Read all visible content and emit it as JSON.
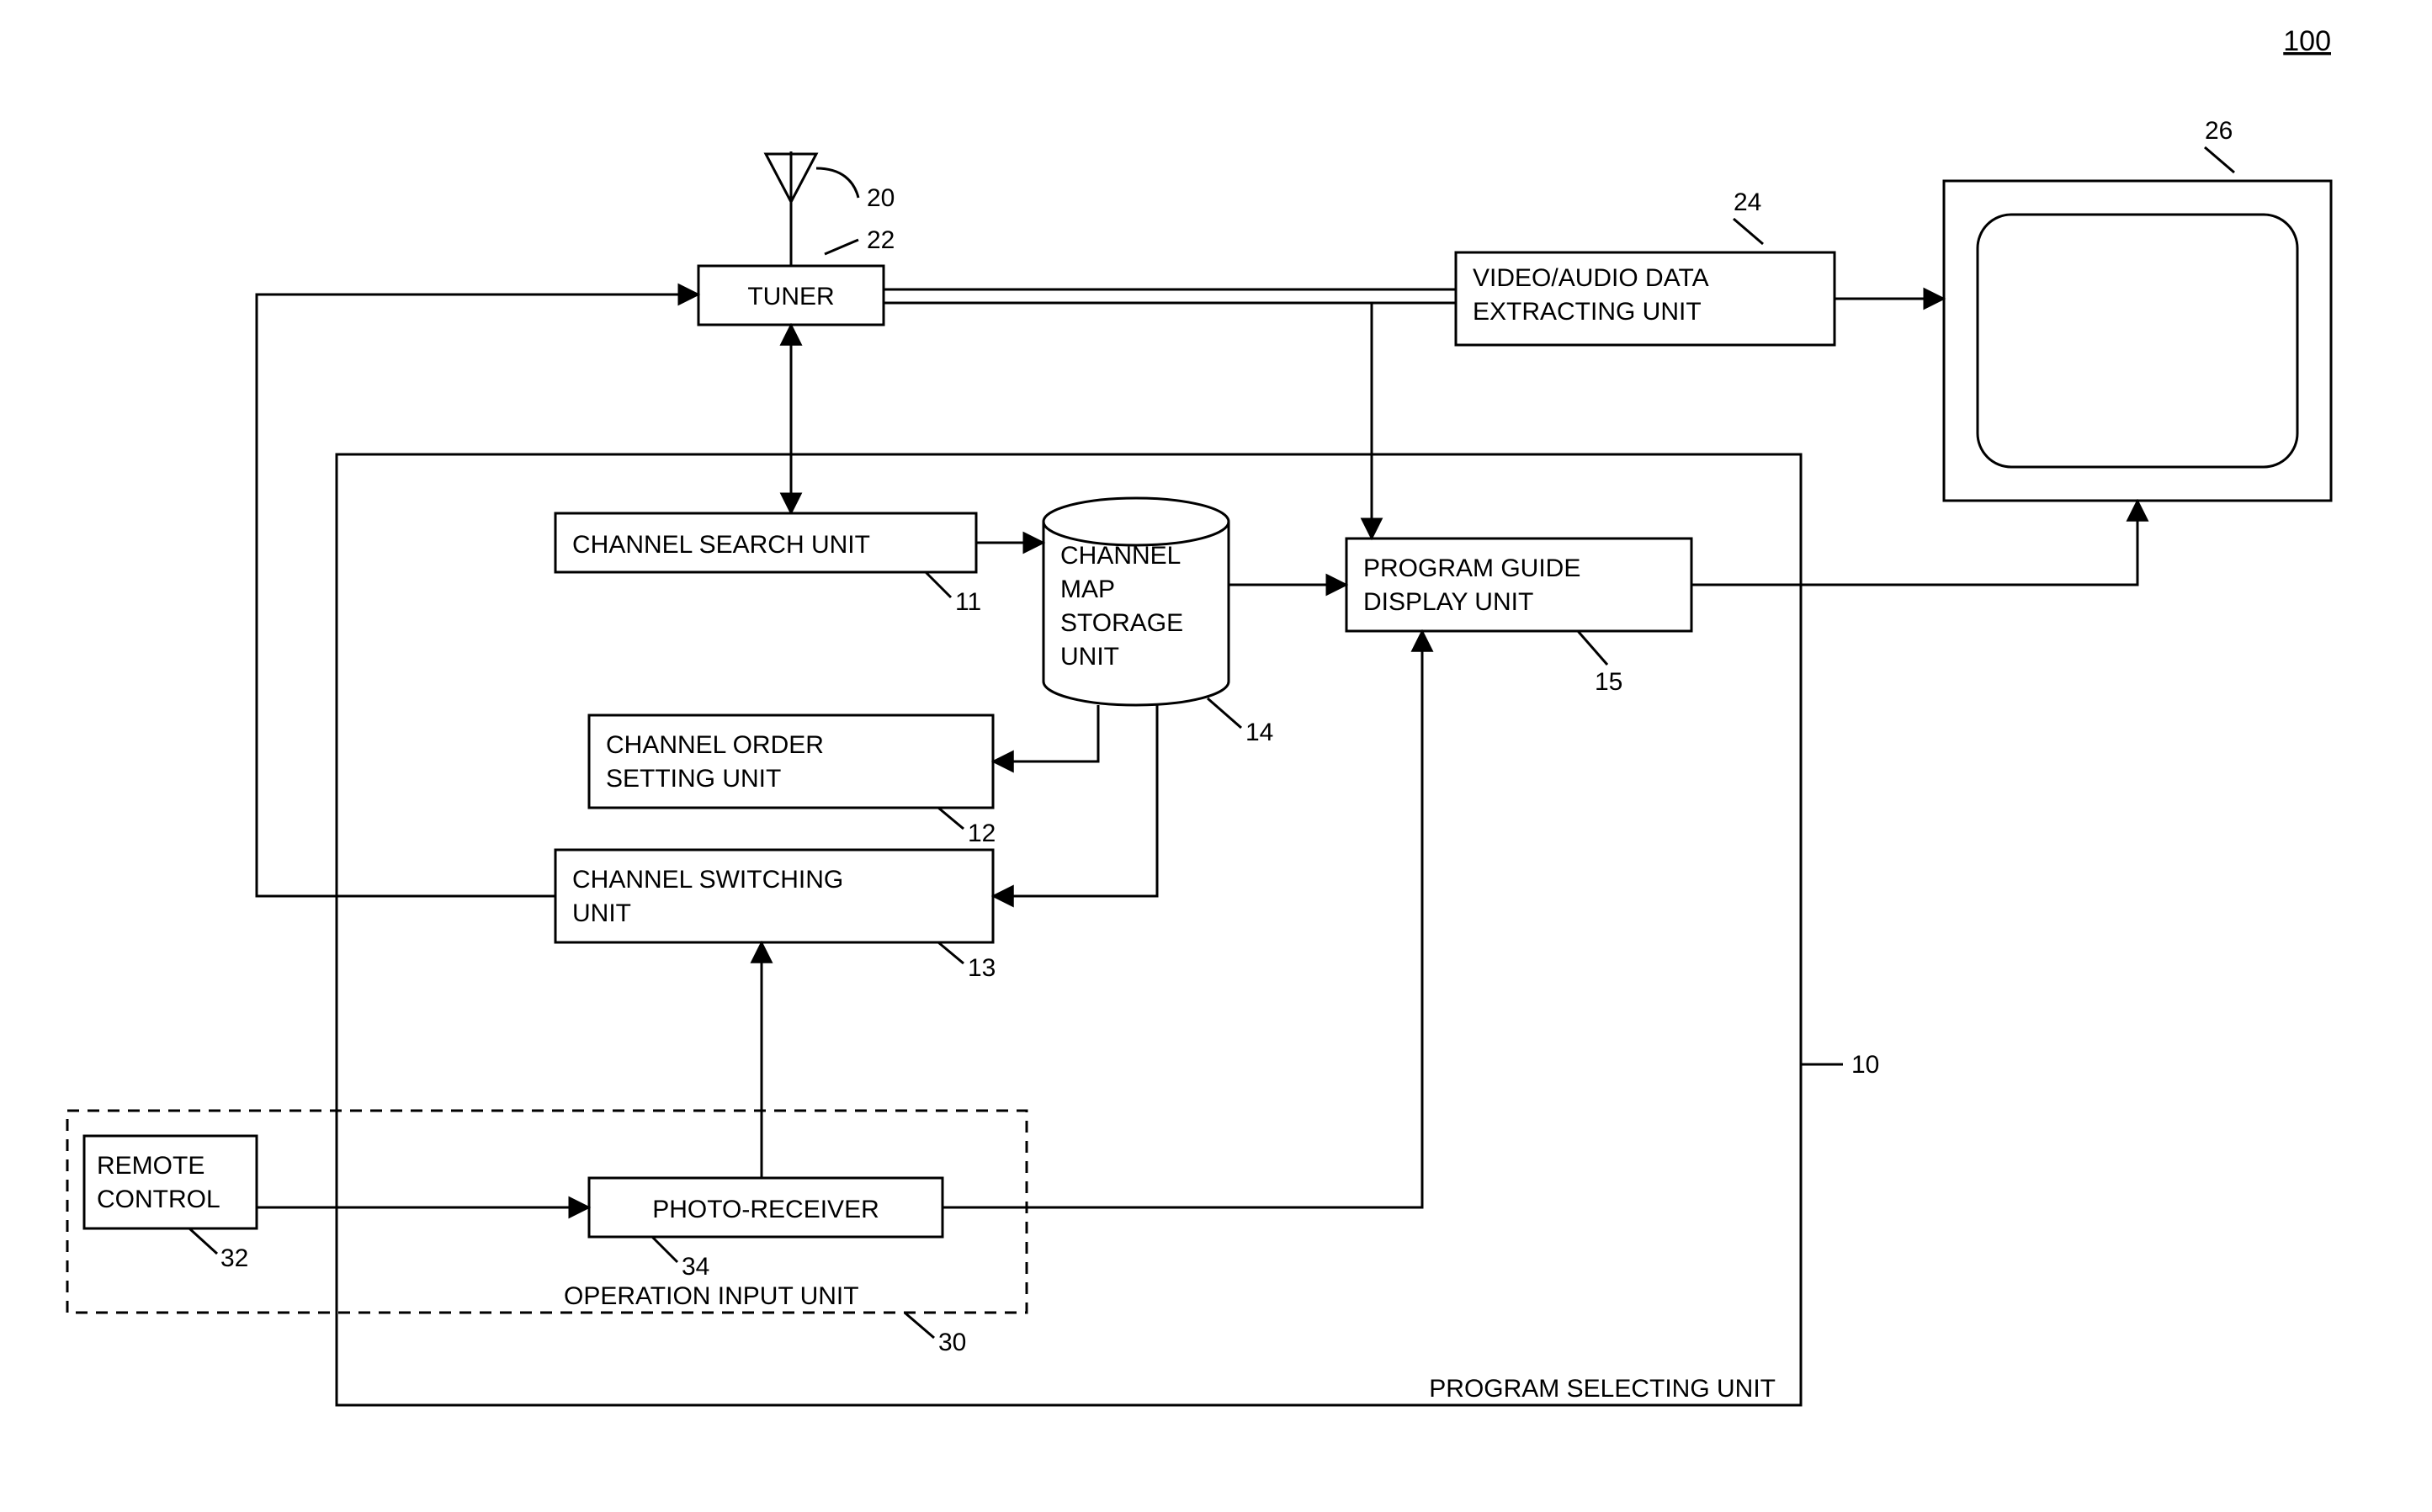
{
  "figure_number": "100",
  "labels": {
    "antenna": "20",
    "tuner_num": "22",
    "tuner": "TUNER",
    "videoaudio_num": "24",
    "videoaudio": "VIDEO/AUDIO DATA",
    "videoaudio2": "EXTRACTING UNIT",
    "tv_num": "26",
    "psu_num": "10",
    "psu_caption": "PROGRAM SELECTING UNIT",
    "csu": "CHANNEL SEARCH UNIT",
    "csu_num": "11",
    "cms1": "CHANNEL",
    "cms2": "MAP",
    "cms3": "STORAGE",
    "cms4": "UNIT",
    "cms_num": "14",
    "cos1": "CHANNEL ORDER",
    "cos2": "SETTING UNIT",
    "cos_num": "12",
    "csw1": "CHANNEL SWITCHING",
    "csw2": "UNIT",
    "csw_num": "13",
    "pgd1": "PROGRAM GUIDE",
    "pgd2": "DISPLAY UNIT",
    "pgd_num": "15",
    "remote1": "REMOTE",
    "remote2": "CONTROL",
    "remote_num": "32",
    "photorx": "PHOTO-RECEIVER",
    "photorx_num": "34",
    "opinput": "OPERATION INPUT UNIT",
    "opinput_num": "30"
  }
}
